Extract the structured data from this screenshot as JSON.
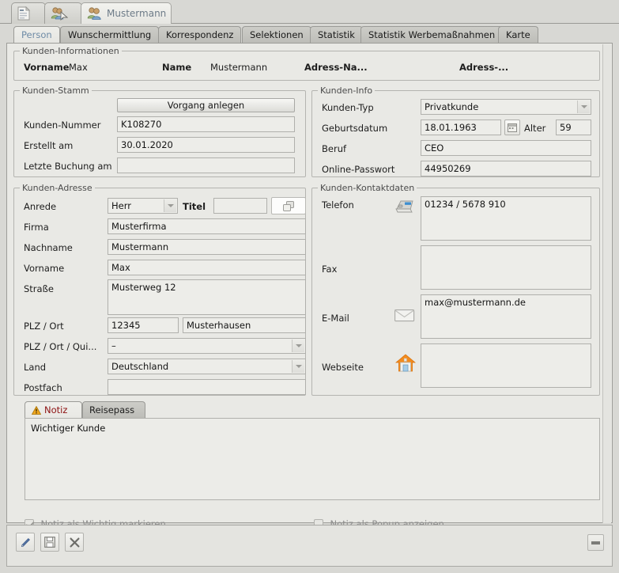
{
  "window_tabs": [
    {
      "id": "document",
      "icon": "document-icon",
      "label": ""
    },
    {
      "id": "customer-search",
      "icon": "users-search-icon",
      "label": ""
    },
    {
      "id": "customer",
      "icon": "users-icon",
      "label": "Mustermann",
      "selected": true
    }
  ],
  "tabs": [
    {
      "label": "Person",
      "selected": true
    },
    {
      "label": "Wunschermittlung",
      "selected": false
    },
    {
      "label": "Korrespondenz",
      "selected": false
    },
    {
      "label": "Selektionen",
      "selected": false
    },
    {
      "label": "Statistik",
      "selected": false
    },
    {
      "label": "Statistik Werbemaßnahmen",
      "selected": false
    },
    {
      "label": "Karte",
      "selected": false
    }
  ],
  "kunden_informationen": {
    "title": "Kunden-Informationen",
    "vorname_label": "Vorname",
    "vorname_value": "Max",
    "name_label": "Name",
    "name_value": "Mustermann",
    "adress_na_label": "Adress-Na...",
    "adress_label": "Adress-..."
  },
  "kunden_stamm": {
    "title": "Kunden-Stamm",
    "vorgang_anlegen": "Vorgang anlegen",
    "kunden_nummer_label": "Kunden-Nummer",
    "kunden_nummer_value": "K108270",
    "erstellt_am_label": "Erstellt am",
    "erstellt_am_value": "30.01.2020",
    "letzte_buchung_label": "Letzte Buchung am",
    "letzte_buchung_value": ""
  },
  "kunden_info": {
    "title": "Kunden-Info",
    "kunden_typ_label": "Kunden-Typ",
    "kunden_typ_value": "Privatkunde",
    "geburtsdatum_label": "Geburtsdatum",
    "geburtsdatum_value": "18.01.1963",
    "alter_label": "Alter",
    "alter_value": "59",
    "beruf_label": "Beruf",
    "beruf_value": "CEO",
    "online_passwort_label": "Online-Passwort",
    "online_passwort_value": "44950269"
  },
  "kunden_adresse": {
    "title": "Kunden-Adresse",
    "anrede_label": "Anrede",
    "anrede_value": "Herr",
    "titel_label": "Titel",
    "titel_value": "",
    "firma_label": "Firma",
    "firma_value": "Musterfirma",
    "nachname_label": "Nachname",
    "nachname_value": "Mustermann",
    "vorname_label": "Vorname",
    "vorname_value": "Max",
    "strasse_label": "Straße",
    "strasse_value": "Musterweg 12",
    "plz_ort_label": "PLZ / Ort",
    "plz_value": "12345",
    "ort_value": "Musterhausen",
    "plz_ort_qui_label": "PLZ / Ort / Qui...",
    "plz_ort_qui_value": "–",
    "land_label": "Land",
    "land_value": "Deutschland",
    "postfach_label": "Postfach",
    "postfach_value": ""
  },
  "kunden_kontaktdaten": {
    "title": "Kunden-Kontaktdaten",
    "telefon_label": "Telefon",
    "telefon_value": "01234 / 5678 910",
    "fax_label": "Fax",
    "fax_value": "",
    "email_label": "E-Mail",
    "email_value": "max@mustermann.de",
    "webseite_label": "Webseite",
    "webseite_value": ""
  },
  "notiz": {
    "tabs": [
      {
        "label": "Notiz",
        "icon": "warning-icon",
        "selected": true
      },
      {
        "label": "Reisepass",
        "icon": "",
        "selected": false
      }
    ],
    "text": "Wichtiger Kunde",
    "wichtig_label": "Notiz als Wichtig markieren",
    "wichtig_checked": true,
    "popup_label": "Notiz als Popup anzeigen",
    "popup_checked": false
  },
  "toolbar": {
    "edit_icon": "pencil-icon",
    "save_icon": "floppy-disk-icon",
    "delete_icon": "close-x-icon",
    "collapse_icon": "minimize-icon"
  },
  "colors": {
    "accent": "#6e8ba6",
    "notiz_red": "#8d1212",
    "panel_bg": "#e9e9e5",
    "field_bg": "#edede9"
  }
}
